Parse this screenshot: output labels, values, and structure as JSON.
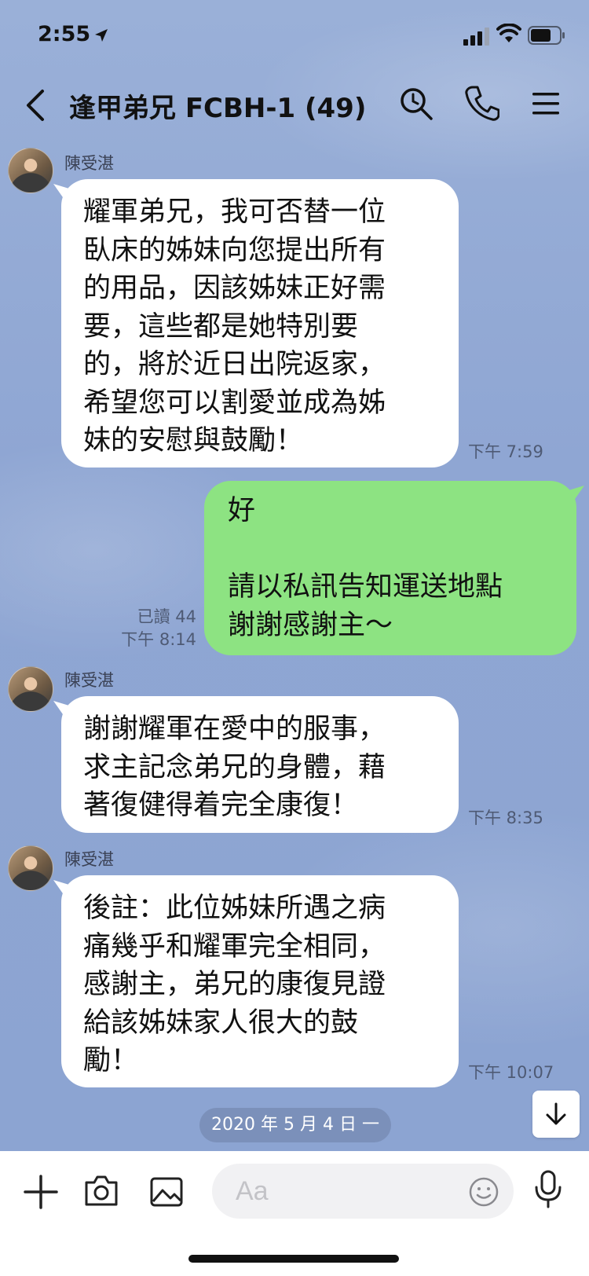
{
  "status_bar": {
    "time": "2:55"
  },
  "header": {
    "title": "逢甲弟兄 FCBH-1 (49)"
  },
  "messages": [
    {
      "sender": "陳受湛",
      "text": "耀軍弟兄，我可否替一位\n臥床的姊妹向您提出所有\n的用品，因該姊妹正好需\n要，這些都是她特別要\n的，將於近日出院返家，\n希望您可以割愛並成為姊\n妹的安慰與鼓勵！",
      "time": "下午 7:59"
    },
    {
      "sender": "me",
      "text": "好\n\n請以私訊告知運送地點\n謝謝感謝主～",
      "read": "已讀 44",
      "time": "下午 8:14"
    },
    {
      "sender": "陳受湛",
      "text": "謝謝耀軍在愛中的服事，\n求主記念弟兄的身體，藉\n著復健得着完全康復！",
      "time": "下午 8:35"
    },
    {
      "sender": "陳受湛",
      "text": "後註：此位姊妹所遇之病\n痛幾乎和耀軍完全相同，\n感謝主，弟兄的康復見證\n給該姊妹家人很大的鼓\n勵！",
      "time": "下午 10:07"
    }
  ],
  "date_separator": "2020 年 5 月 4 日 一",
  "input": {
    "placeholder": "Aa"
  },
  "colors": {
    "chat_background": "#8ea6d3",
    "incoming_bubble": "#ffffff",
    "outgoing_bubble": "#8de382",
    "input_bar": "#ffffff"
  },
  "icons": [
    "location-arrow-icon",
    "signal-icon",
    "wifi-icon",
    "battery-icon",
    "back-chevron-icon",
    "search-icon",
    "phone-icon",
    "menu-icon",
    "arrow-down-icon",
    "plus-icon",
    "camera-icon",
    "image-icon",
    "emoji-icon",
    "microphone-icon"
  ]
}
